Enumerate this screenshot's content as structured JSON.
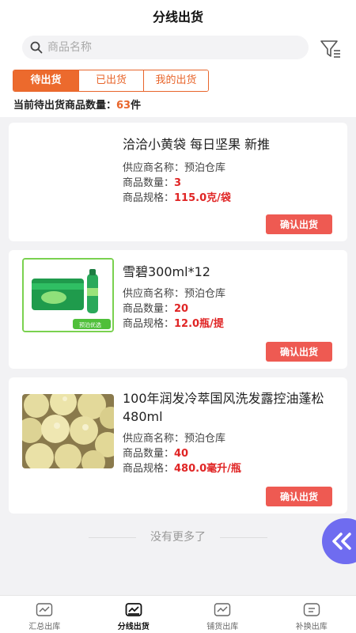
{
  "header": {
    "title": "分线出货"
  },
  "search": {
    "placeholder": "商品名称"
  },
  "tabs": [
    {
      "label": "待出货",
      "active": true
    },
    {
      "label": "已出货",
      "active": false
    },
    {
      "label": "我的出货",
      "active": false
    }
  ],
  "summary": {
    "label": "当前待出货商品数量：",
    "count": "63",
    "unit": "件"
  },
  "cards": [
    {
      "name": "洽洽小黄袋 每日坚果 新推",
      "supplier_label": "供应商名称：",
      "supplier": "预泊仓库",
      "qty_label": "商品数量：",
      "qty": "3",
      "spec_label": "商品规格：",
      "spec": "115.0克/袋",
      "button": "确认出货"
    },
    {
      "name": "雪碧300ml*12",
      "supplier_label": "供应商名称：",
      "supplier": "预泊仓库",
      "qty_label": "商品数量：",
      "qty": "20",
      "spec_label": "商品规格：",
      "spec": "12.0瓶/提",
      "button": "确认出货",
      "image_badge": "预泊优选"
    },
    {
      "name": "100年润发冷萃国风洗发露控油蓬松480ml",
      "supplier_label": "供应商名称：",
      "supplier": "预泊仓库",
      "qty_label": "商品数量：",
      "qty": "40",
      "spec_label": "商品规格：",
      "spec": "480.0毫升/瓶",
      "button": "确认出货"
    }
  ],
  "footer_text": "没有更多了",
  "bottom_nav": [
    {
      "label": "汇总出库",
      "icon": "summary-outbound-icon",
      "active": false
    },
    {
      "label": "分线出货",
      "icon": "line-shipping-icon",
      "active": true
    },
    {
      "label": "铺货出库",
      "icon": "distribution-outbound-icon",
      "active": false
    },
    {
      "label": "补换出库",
      "icon": "exchange-outbound-icon",
      "active": false
    }
  ],
  "colors": {
    "accent": "#ec6a2d",
    "danger": "#e02525",
    "button": "#ee5a52",
    "float": "#6f6cf0"
  }
}
